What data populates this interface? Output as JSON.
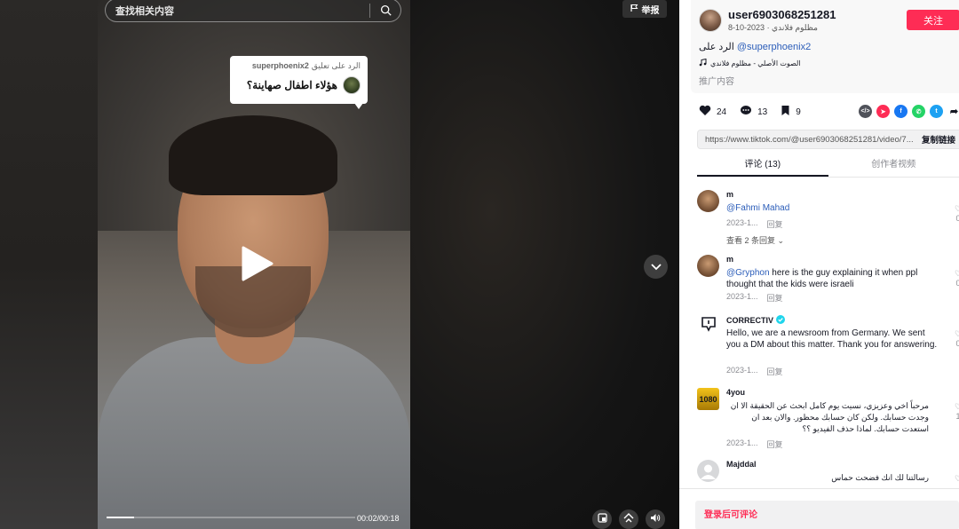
{
  "video": {
    "search_placeholder": "查找相关内容",
    "report_label": "举报",
    "reply_bubble": {
      "prefix": "الرد على تعليق",
      "username": "superphoenix2",
      "text": "هؤلاء اطفال صهاينة؟"
    },
    "time": "00:02/00:18",
    "progress": 0.11
  },
  "author": {
    "username": "user6903068251281",
    "meta": "مظلوم فلاندي · 2023-10-8",
    "follow_label": "关注",
    "desc_prefix": "الرد على",
    "desc_mention": "@superphoenix2",
    "music": "الصوت الأصلي - مظلوم فلاندي",
    "recommend": "推广内容"
  },
  "stats": {
    "likes": "24",
    "comments": "13",
    "saves": "9"
  },
  "share": {
    "url": "https://www.tiktok.com/@user6903068251281/video/7...",
    "copy_label": "复制链接"
  },
  "tabs": [
    {
      "label": "评论 (13)"
    },
    {
      "label": "创作者视频"
    }
  ],
  "comments": [
    {
      "user": "m",
      "mention": "@Fahmi Mahad",
      "text": "",
      "date": "2023-1...",
      "reply": "回复",
      "likes": "0",
      "view_replies": "查看 2 条回复"
    },
    {
      "user": "m",
      "mention": "@Gryphon",
      "text": " here is the guy explaining it when ppl thought that the kids were israeli",
      "date": "2023-1...",
      "reply": "回复",
      "likes": "0"
    },
    {
      "user": "CORRECTIV",
      "mention": "",
      "text": "Hello, we are a newsroom from Germany. We sent you a DM about this matter. Thank you for answering.",
      "date": "2023-1...",
      "reply": "回复",
      "likes": "0"
    },
    {
      "user": "4you",
      "mention": "",
      "text": "مرحباً اخي وعزيزي، نسيت يوم كامل ابحث عن الحقيقة الا ان وجدت حسابك. ولكن كان حسابك محظور. والان بعد ان استعدت حسابك. لماذا حذف الفيديو ؟؟",
      "date": "2023-1...",
      "reply": "回复",
      "likes": "1"
    },
    {
      "user": "Majddal",
      "mention": "",
      "text": "رسالتنا لك انك فضحت حماس",
      "date": "",
      "reply": "",
      "likes": ""
    }
  ],
  "login_prompt": "登录后可评论",
  "colors": {
    "accent": "#fe2c55",
    "mention": "#2b5db9"
  }
}
